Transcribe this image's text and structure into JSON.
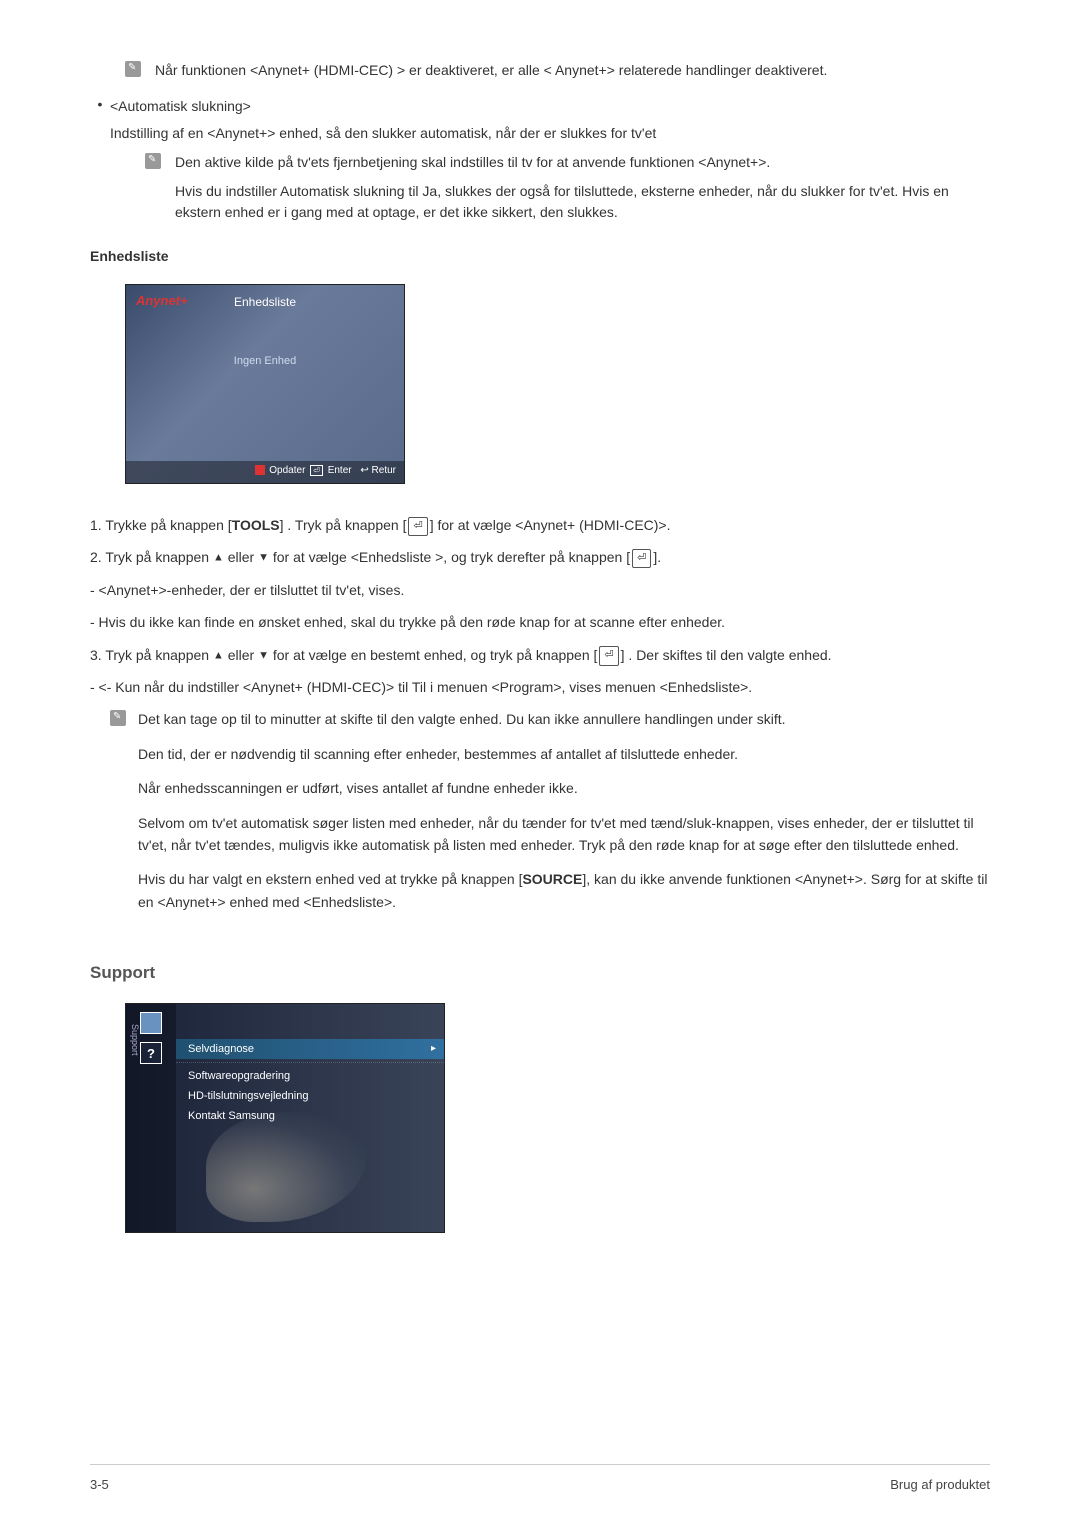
{
  "topNote": "Når funktionen <Anynet+ (HDMI-CEC) > er deaktiveret, er alle < Anynet+> relaterede handlinger deaktiveret.",
  "autoOff": {
    "title": "<Automatisk slukning>",
    "desc": "Indstilling af en <Anynet+> enhed, så den slukker automatisk, når der er slukkes for tv'et",
    "note1": "Den aktive kilde på tv'ets fjernbetjening skal indstilles til tv for at anvende funktionen <Anynet+>.",
    "note2": "Hvis du indstiller Automatisk slukning til Ja, slukkes der også for tilsluttede, eksterne enheder, når du slukker for tv'et. Hvis en ekstern enhed er i gang med at optage, er det ikke sikkert, den slukkes."
  },
  "enhedsliste": {
    "heading": "Enhedsliste",
    "logo": "Anynet+",
    "title": "Enhedsliste",
    "middle": "Ingen Enhed",
    "footer_update": "Opdater",
    "footer_enter": "Enter",
    "footer_return": "Retur"
  },
  "steps": {
    "s1a": "1. Trykke på knappen [",
    "tools": "TOOLS",
    "s1b": "] . Tryk på knappen [",
    "s1c": "] for at vælge <Anynet+ (HDMI-CEC)>.",
    "s2a": "2. Tryk på knappen ",
    "s2b": " eller ",
    "s2c": " for at vælge <Enhedsliste >, og tryk derefter på knappen [",
    "s2d": "].",
    "d1": "- <Anynet+>-enheder, der er tilsluttet til tv'et, vises.",
    "d2": "- Hvis du ikke kan finde en ønsket enhed, skal du trykke på den røde knap for at scanne efter enheder.",
    "s3a": "3. Tryk på knappen ",
    "s3b": " eller ",
    "s3c": " for at vælge en bestemt enhed, og tryk på knappen [",
    "s3d": "] . Der skiftes til den valgte enhed.",
    "d3": "- <- Kun når du indstiller <Anynet+ (HDMI-CEC)> til Til i menuen <Program>, vises menuen <Enhedsliste>."
  },
  "notes": {
    "n1": "Det kan tage op til to minutter at skifte til den valgte enhed. Du kan ikke annullere handlingen under skift.",
    "n2": "Den tid, der er nødvendig til scanning efter enheder, bestemmes af antallet af tilsluttede enheder.",
    "n3": "Når enhedsscanningen er udført, vises antallet af fundne enheder ikke.",
    "n4": "Selvom om tv'et automatisk søger listen med enheder, når du tænder for tv'et med tænd/sluk-knappen, vises enheder, der er tilsluttet til tv'et, når tv'et tændes, muligvis ikke automatisk på listen med enheder. Tryk på den røde knap for at søge efter den tilsluttede enhed.",
    "n5a": "Hvis du har valgt en ekstern enhed ved at trykke på knappen [",
    "source": "SOURCE",
    "n5b": "], kan du ikke anvende funktionen <Anynet+>. Sørg for at skifte til en <Anynet+> enhed med <Enhedsliste>."
  },
  "support": {
    "heading": "Support",
    "side_label": "Support",
    "q": "?",
    "items": [
      "Selvdiagnose",
      "Softwareopgradering",
      "HD-tilslutningsvejledning",
      "Kontakt Samsung"
    ]
  },
  "footer": {
    "left": "3-5",
    "right": "Brug af produktet"
  },
  "icons": {
    "enter": "⏎",
    "up": "▲",
    "down": "▼"
  }
}
